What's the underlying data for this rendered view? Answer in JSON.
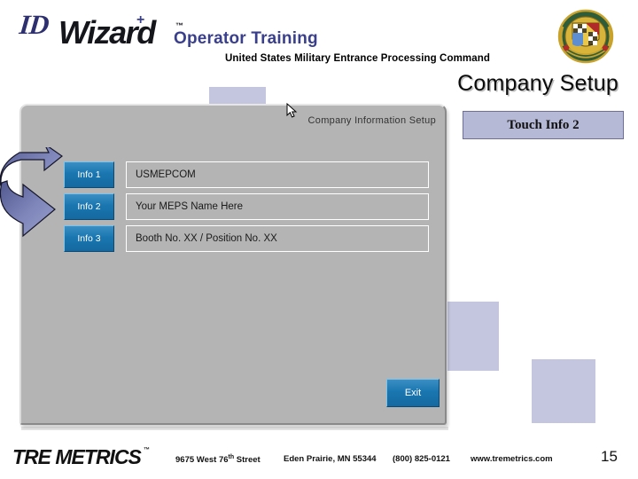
{
  "brand": {
    "logo_id": "ID",
    "logo_wizard": "Wizard",
    "logo_plus": "+",
    "logo_tm": "™"
  },
  "header": {
    "title": "Operator Training",
    "subtitle": "United States Military Entrance Processing Command",
    "crest_icon": "military-crest-icon"
  },
  "page_title": "Company Setup",
  "callout": {
    "label": "Touch Info 2",
    "bg_color": "#b6b9d6",
    "border_color": "#6d6f96"
  },
  "app_window": {
    "title": "Company Information Setup",
    "rows": [
      {
        "button": "Info 1",
        "value": "USMEPCOM"
      },
      {
        "button": "Info 2",
        "value": "Your MEPS Name Here"
      },
      {
        "button": "Info 3",
        "value": "Booth No. XX / Position No. XX"
      }
    ],
    "exit_label": "Exit",
    "button_color": "#1a76b0"
  },
  "annotation": {
    "arrow_icon": "curved-arrow-icon",
    "cursor_icon": "mouse-pointer-icon"
  },
  "footer": {
    "company": "TRE METRICS",
    "company_tm": "™",
    "street": "9675 West 76",
    "street_sup": "th",
    "street_tail": " Street",
    "city": "Eden Prairie, MN 55344",
    "phone": "(800) 825-0121",
    "website": "www.tremetrics.com",
    "page_number": "15"
  }
}
